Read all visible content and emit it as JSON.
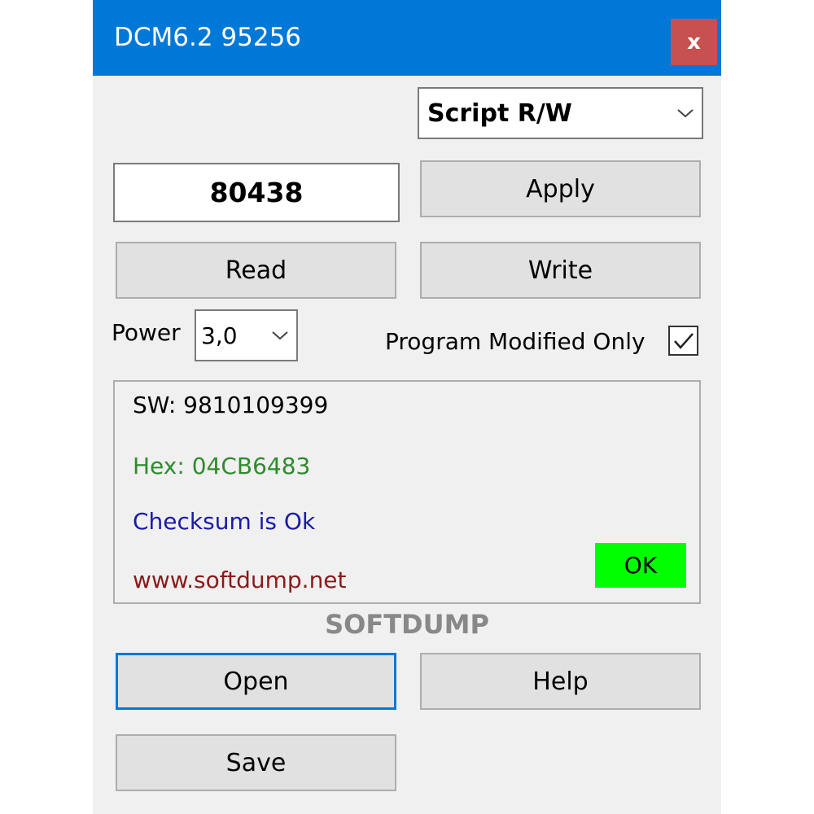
{
  "window": {
    "title": "DCM6.2 95256",
    "close_label": "x"
  },
  "mode_select": {
    "selected": "Script R/W"
  },
  "value_field": {
    "value": "80438"
  },
  "buttons": {
    "apply": "Apply",
    "read": "Read",
    "write": "Write",
    "open": "Open",
    "help": "Help",
    "save": "Save"
  },
  "power": {
    "label": "Power",
    "selected": "3,0"
  },
  "program_modified": {
    "label": "Program Modified Only",
    "checked": true
  },
  "info": {
    "sw": "SW: 9810109399",
    "hex": "Hex: 04CB6483",
    "checksum": "Checksum is Ok",
    "website": "www.softdump.net",
    "status": "OK"
  },
  "brand": "SOFTDUMP",
  "colors": {
    "titlebar": "#0078d7",
    "close": "#c75050",
    "hex_text": "#2e8b2e",
    "checksum_text": "#1a1aaa",
    "website_text": "#8b1a1a",
    "ok_badge": "#00ff00"
  },
  "icons": {
    "dropdown": "chevron-down-icon",
    "check": "check-icon"
  }
}
